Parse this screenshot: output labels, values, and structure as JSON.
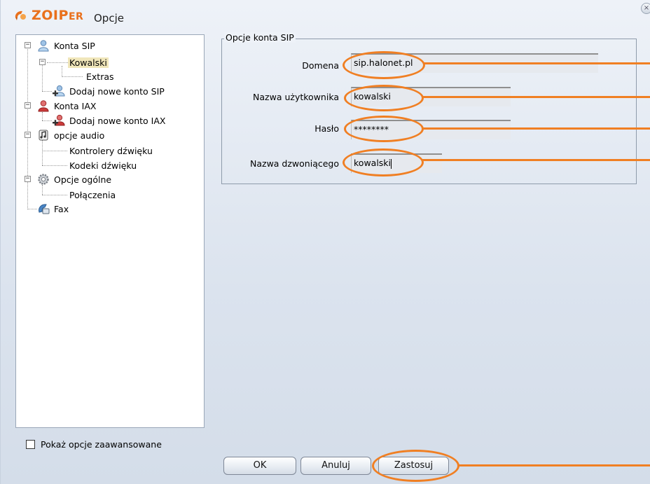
{
  "window": {
    "brand_main": "ZOIP",
    "brand_suffix": "ER",
    "title": "Opcje",
    "close_glyph": "×"
  },
  "tree": {
    "items": [
      {
        "label": "Konta SIP",
        "icon": "sip-accounts-icon"
      },
      {
        "label": "Kowalski",
        "selected": true
      },
      {
        "label": "Extras"
      },
      {
        "label": "Dodaj nowe konto SIP",
        "icon": "add-user-icon"
      },
      {
        "label": "Konta IAX",
        "icon": "iax-accounts-icon"
      },
      {
        "label": "Dodaj nowe konto IAX",
        "icon": "add-user-red-icon"
      },
      {
        "label": "opcje audio",
        "icon": "audio-icon"
      },
      {
        "label": "Kontrolery dźwięku"
      },
      {
        "label": "Kodeki dźwięku"
      },
      {
        "label": "Opcje ogólne",
        "icon": "gear-icon"
      },
      {
        "label": "Połączenia"
      },
      {
        "label": "Fax",
        "icon": "fax-icon"
      }
    ]
  },
  "advanced": {
    "label": "Pokaż opcje zaawansowane",
    "checked": false
  },
  "sip_options": {
    "legend": "Opcje konta SIP",
    "fields": [
      {
        "label": "Domena",
        "value": "sip.halonet.pl"
      },
      {
        "label": "Nazwa użytkownika",
        "value": "kowalski"
      },
      {
        "label": "Hasło",
        "value": "********"
      },
      {
        "label": "Nazwa dzwoniącego",
        "value": "kowalski"
      }
    ]
  },
  "buttons": {
    "ok": "OK",
    "cancel": "Anuluj",
    "apply": "Zastosuj"
  },
  "colors": {
    "highlight": "#f07f23",
    "brand": "#e9701c",
    "selection": "#f0e6ba"
  }
}
